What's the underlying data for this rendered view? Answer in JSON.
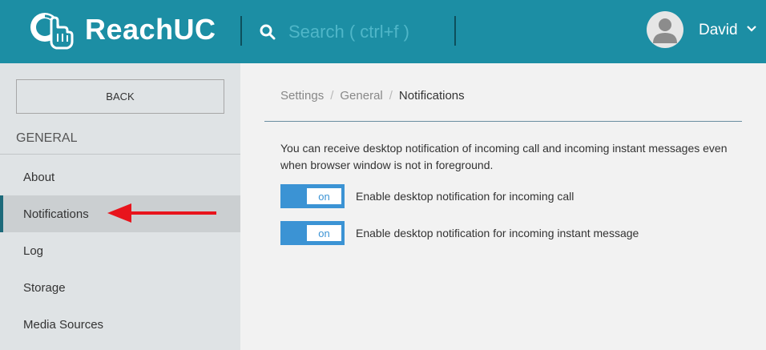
{
  "colors": {
    "header": "#1c8ea4",
    "sidebar": "#dfe3e5",
    "sidebar_active": "#cbcfd1",
    "toggle": "#3b93d4",
    "annotation_arrow": "#e8141c"
  },
  "header": {
    "app_name": "ReachUC",
    "logo_icon": "reachuc-hand-logo-icon",
    "search": {
      "placeholder": "Search ( ctrl+f )",
      "value": "",
      "icon": "search-icon"
    },
    "user": {
      "name": "David",
      "avatar_icon": "user-avatar-icon",
      "menu_icon": "chevron-down-icon"
    }
  },
  "sidebar": {
    "back_label": "BACK",
    "section_title": "GENERAL",
    "items": [
      {
        "label": "About",
        "active": false
      },
      {
        "label": "Notifications",
        "active": true
      },
      {
        "label": "Log",
        "active": false
      },
      {
        "label": "Storage",
        "active": false
      },
      {
        "label": "Media Sources",
        "active": false
      }
    ]
  },
  "main": {
    "breadcrumb": [
      "Settings",
      "General",
      "Notifications"
    ],
    "description": "You can receive desktop notification of incoming call and incoming instant messages even when browser window is not in foreground.",
    "toggles": [
      {
        "state": "on",
        "label": "Enable desktop notification for incoming call"
      },
      {
        "state": "on",
        "label": "Enable desktop notification for incoming instant message"
      }
    ]
  }
}
